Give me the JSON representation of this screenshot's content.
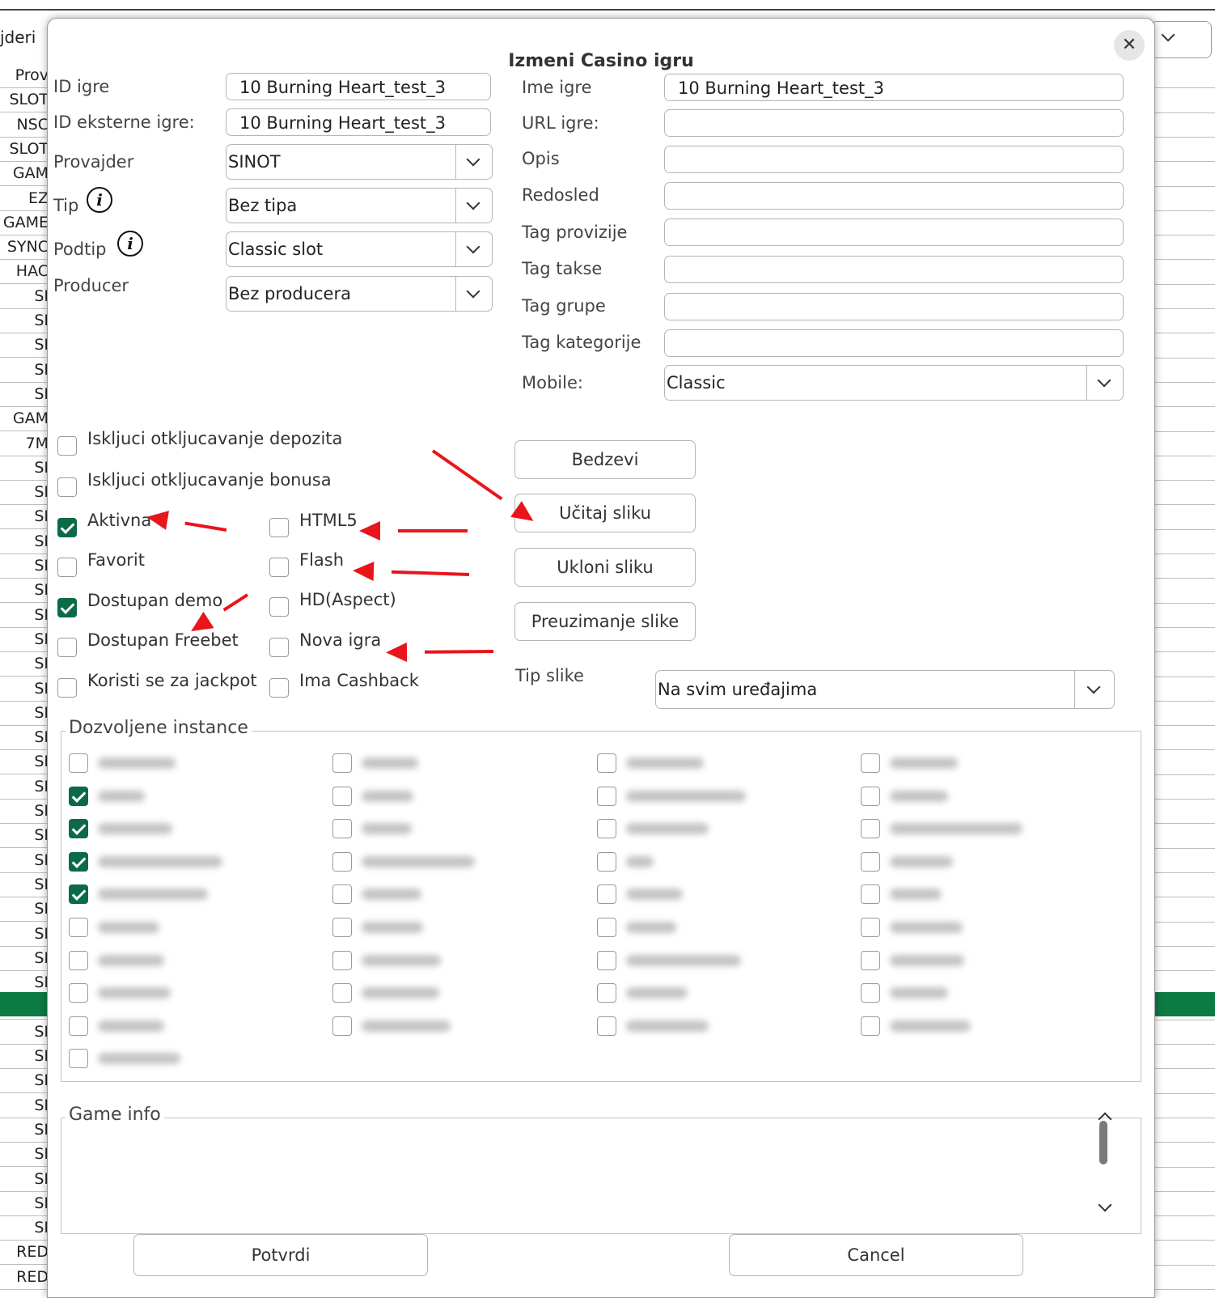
{
  "background": {
    "title_fragment": "jderi",
    "rows": [
      "Prov",
      "SLOT",
      "NSC",
      "SLOT",
      "GAM",
      "EZ",
      "GAME",
      "SYNC",
      "HAC",
      "SI",
      "SI",
      "SI",
      "SI",
      "SI",
      "GAM",
      "7M",
      "SI",
      "SI",
      "SI",
      "SI",
      "SI",
      "SI",
      "SI",
      "SI",
      "SI",
      "SI",
      "SI",
      "SI",
      "SI",
      "SI",
      "SI",
      "SI",
      "SI",
      "SI",
      "SI",
      "SI",
      "SI",
      "SI",
      "SI",
      "SI",
      "SI",
      "SI",
      "SI",
      "SI",
      "SI",
      "SI",
      "SI",
      "SI",
      "RED",
      "RED"
    ]
  },
  "dialog": {
    "title": "Izmeni Casino igru",
    "close_symbol": "✕"
  },
  "left_fields": {
    "id_igre": {
      "label": "ID igre",
      "value": "10 Burning Heart_test_3"
    },
    "id_eksterne": {
      "label": "ID eksterne igre:",
      "value": "10 Burning Heart_test_3"
    },
    "provajder": {
      "label": "Provajder",
      "value": "SINOT"
    },
    "tip": {
      "label": "Tip",
      "value": "Bez tipa"
    },
    "podtip": {
      "label": "Podtip",
      "value": "Classic slot"
    },
    "producer": {
      "label": "Producer",
      "value": "Bez producera"
    },
    "info_glyph": "i"
  },
  "right_fields": {
    "ime_igre": {
      "label": "Ime igre",
      "value": "10 Burning Heart_test_3"
    },
    "url_igre": {
      "label": "URL igre:",
      "value": ""
    },
    "opis": {
      "label": "Opis",
      "value": ""
    },
    "redosled": {
      "label": "Redosled",
      "value": ""
    },
    "tag_provizije": {
      "label": "Tag provizije",
      "value": ""
    },
    "tag_takse": {
      "label": "Tag takse",
      "value": ""
    },
    "tag_grupe": {
      "label": "Tag grupe",
      "value": ""
    },
    "tag_kategorije": {
      "label": "Tag kategorije",
      "value": ""
    },
    "mobile": {
      "label": "Mobile:",
      "value": "Classic"
    }
  },
  "checkboxes": {
    "iskljuci_depozit": {
      "label": "Iskljuci otkljucavanje depozita",
      "checked": false
    },
    "iskljuci_bonus": {
      "label": "Iskljuci otkljucavanje bonusa",
      "checked": false
    },
    "aktivna": {
      "label": "Aktivna",
      "checked": true
    },
    "html5": {
      "label": "HTML5",
      "checked": false
    },
    "favorit": {
      "label": "Favorit",
      "checked": false
    },
    "flash": {
      "label": "Flash",
      "checked": false
    },
    "dostupan_demo": {
      "label": "Dostupan demo",
      "checked": true
    },
    "hd_aspect": {
      "label": "HD(Aspect)",
      "checked": false
    },
    "dostupan_freebet": {
      "label": "Dostupan Freebet",
      "checked": false
    },
    "nova_igra": {
      "label": "Nova igra",
      "checked": false
    },
    "jackpot": {
      "label": "Koristi se za jackpot",
      "checked": false
    },
    "cashback": {
      "label": "Ima Cashback",
      "checked": false
    }
  },
  "image_buttons": {
    "bedzevi": "Bedzevi",
    "ucitaj": "Učitaj sliku",
    "ukloni": "Ukloni sliku",
    "preuzimanje": "Preuzimanje slike"
  },
  "tip_slike": {
    "label": "Tip slike",
    "value": "Na svim uređajima"
  },
  "instances": {
    "legend": "Dozvoljene instance",
    "columns": [
      [
        true,
        true,
        true,
        true,
        true,
        false,
        false,
        false,
        false,
        false
      ],
      [
        false,
        false,
        false,
        false,
        false,
        false,
        false,
        false,
        false
      ],
      [
        false,
        false,
        false,
        false,
        false,
        false,
        false,
        false,
        false
      ],
      [
        false,
        false,
        false,
        false,
        false,
        false,
        false,
        false,
        false
      ]
    ],
    "first_column_checked": [
      false,
      true,
      true,
      true,
      true,
      false,
      false,
      false,
      false,
      false
    ]
  },
  "game_info": {
    "legend": "Game info",
    "value": ""
  },
  "footer": {
    "confirm": "Potvrdi",
    "cancel": "Cancel"
  },
  "colors": {
    "accent_green": "#0c6a46",
    "annotation_red": "#e8151b"
  }
}
